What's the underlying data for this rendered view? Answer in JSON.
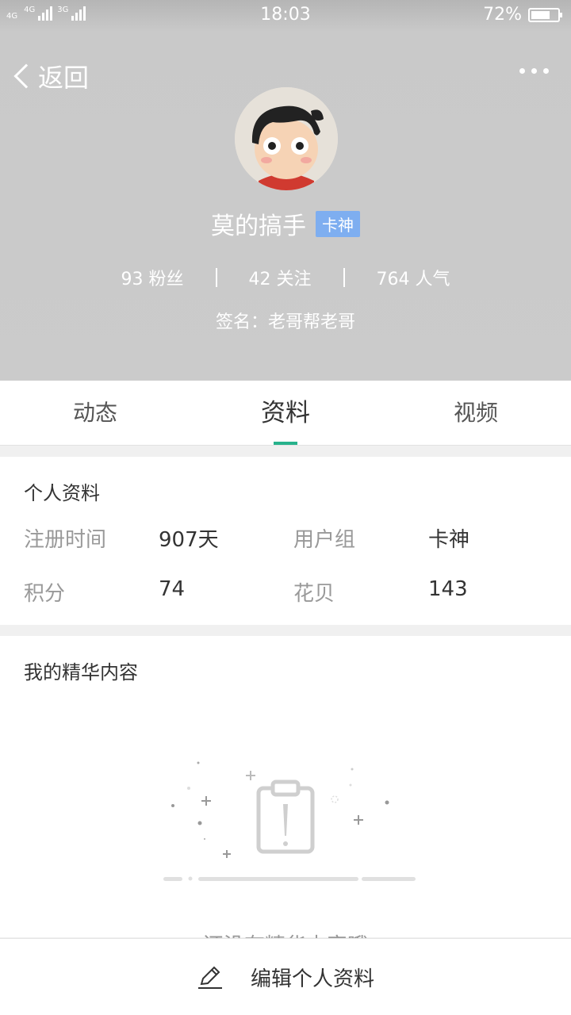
{
  "status_bar": {
    "network_1": "4G",
    "network_2": "4G",
    "network_3": "3G",
    "time": "18:03",
    "battery_percent": "72%",
    "battery_level": 0.72
  },
  "nav": {
    "back_label": "返回",
    "more_icon": "more-dots-icon"
  },
  "profile": {
    "name": "莫的搞手",
    "badge": "卡神",
    "stats": [
      {
        "label": "93 粉丝"
      },
      {
        "label": "42 关注"
      },
      {
        "label": "764 人气"
      }
    ],
    "signature": "签名：老哥帮老哥"
  },
  "tabs": [
    {
      "label": "动态",
      "active": false
    },
    {
      "label": "资料",
      "active": true
    },
    {
      "label": "视频",
      "active": false
    }
  ],
  "personal_info": {
    "title": "个人资料",
    "rows": [
      {
        "label_1": "注册时间",
        "value_1": "907天",
        "label_2": "用户组",
        "value_2": "卡神"
      },
      {
        "label_1": "积分",
        "value_1": "74",
        "label_2": "花贝",
        "value_2": "143"
      }
    ]
  },
  "featured": {
    "title": "我的精华内容",
    "empty_text": "还没有精华内容哦"
  },
  "bottom": {
    "edit_label": "编辑个人资料",
    "edit_icon": "pencil-icon"
  },
  "colors": {
    "accent": "#27b28c",
    "badge": "#7eaef0",
    "header_bg": "#cbcbcb"
  }
}
